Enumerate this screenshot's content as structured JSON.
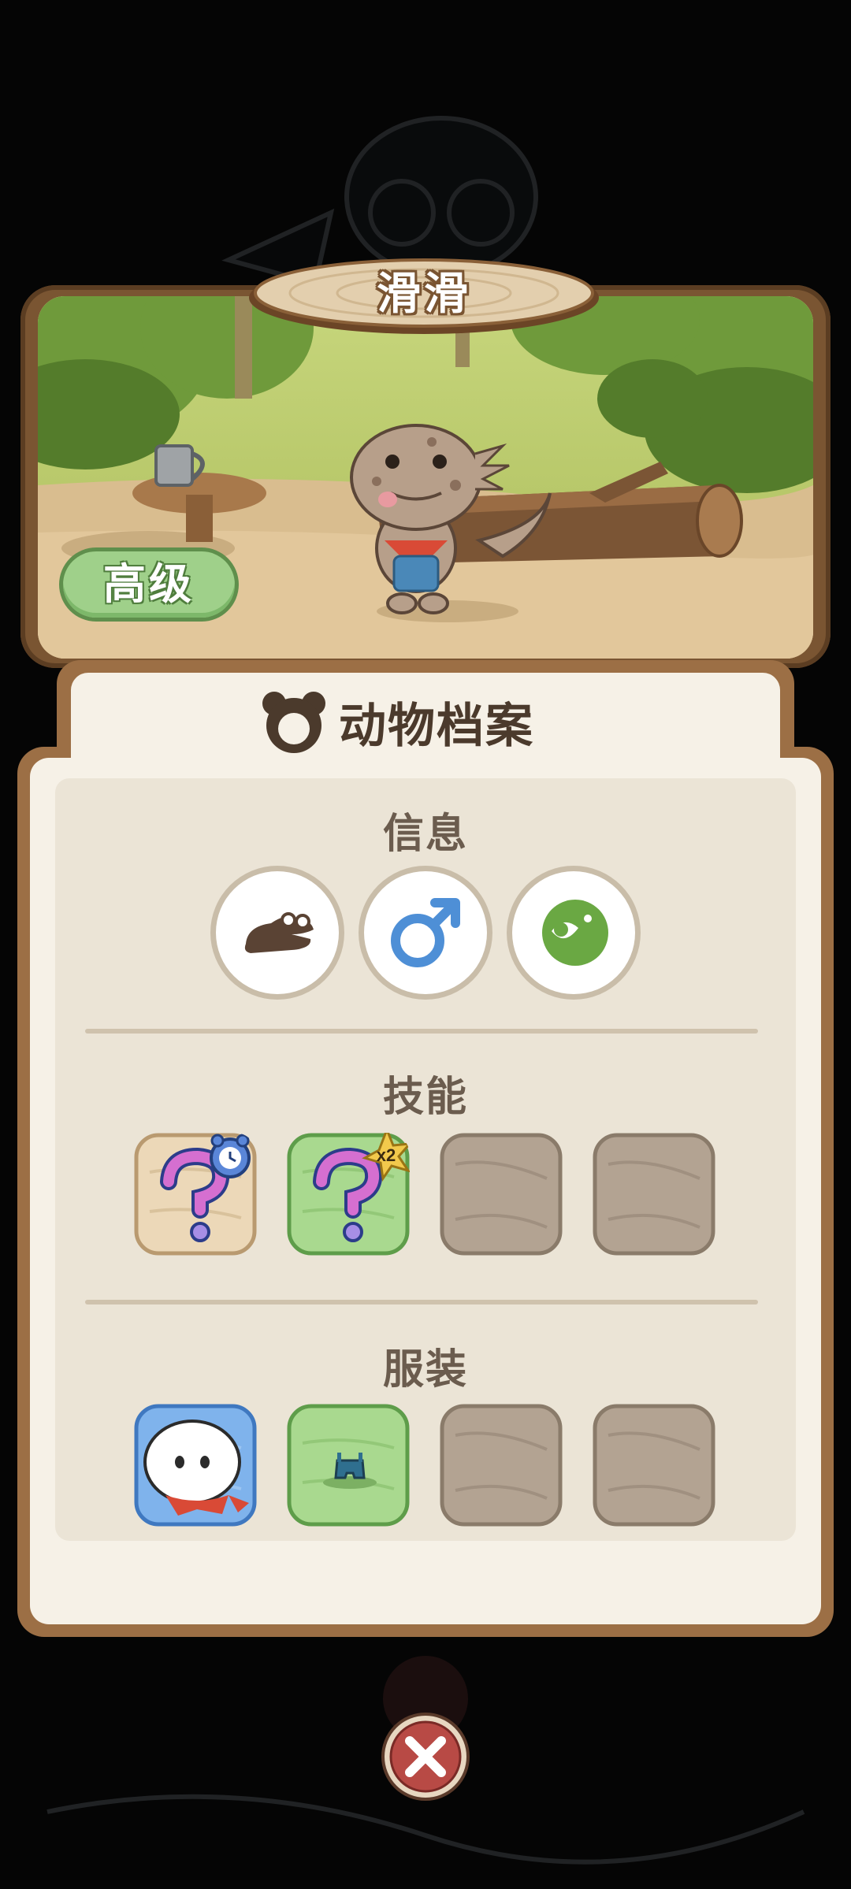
{
  "animal": {
    "name": "滑滑",
    "grade": "高级"
  },
  "panel": {
    "title": "动物档案",
    "title_icon": "bear-head-icon",
    "sections": {
      "info": "信息",
      "skills": "技能",
      "outfits": "服装"
    }
  },
  "info_icons": [
    "crocodile-species-icon",
    "male-gender-icon",
    "eating-diet-icon"
  ],
  "skills": [
    {
      "icon": "question-mark-icon",
      "badge": "alarm-clock-badge",
      "style": "tan"
    },
    {
      "icon": "question-mark-icon",
      "badge": "x2",
      "style": "green"
    },
    {
      "icon": "empty-slot",
      "style": "locked"
    },
    {
      "icon": "empty-slot",
      "style": "locked"
    }
  ],
  "outfits": [
    {
      "icon": "white-head-red-scarf-icon",
      "style": "blue"
    },
    {
      "icon": "blue-overalls-icon",
      "style": "green"
    },
    {
      "icon": "empty-slot",
      "style": "locked"
    },
    {
      "icon": "empty-slot",
      "style": "locked"
    }
  ],
  "colors": {
    "frame_brown": "#9c6f45",
    "panel_cream": "#f6f1e7",
    "grade_green": "#9fd08a",
    "close_red": "#b84a45"
  }
}
